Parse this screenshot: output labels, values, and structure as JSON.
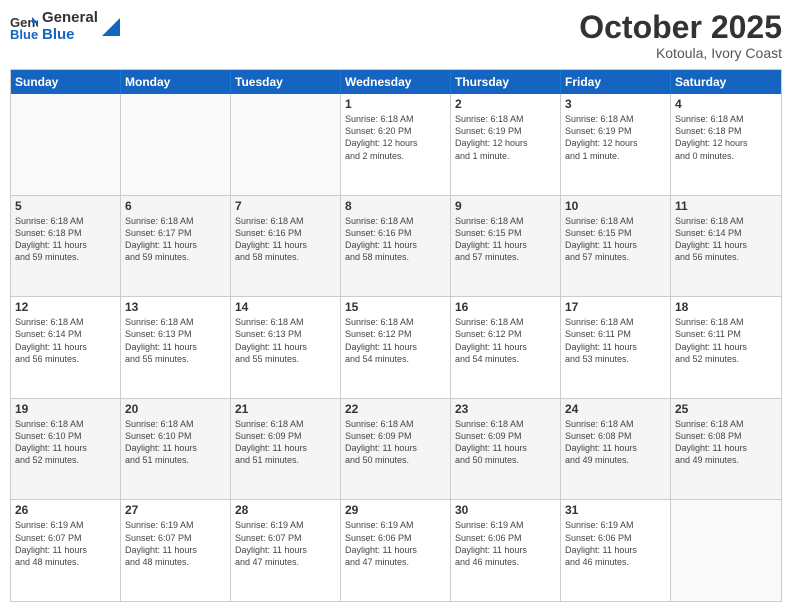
{
  "header": {
    "logo_line1": "General",
    "logo_line2": "Blue",
    "title": "October 2025",
    "subtitle": "Kotoula, Ivory Coast"
  },
  "days_of_week": [
    "Sunday",
    "Monday",
    "Tuesday",
    "Wednesday",
    "Thursday",
    "Friday",
    "Saturday"
  ],
  "weeks": [
    [
      {
        "day": "",
        "info": ""
      },
      {
        "day": "",
        "info": ""
      },
      {
        "day": "",
        "info": ""
      },
      {
        "day": "1",
        "info": "Sunrise: 6:18 AM\nSunset: 6:20 PM\nDaylight: 12 hours\nand 2 minutes."
      },
      {
        "day": "2",
        "info": "Sunrise: 6:18 AM\nSunset: 6:19 PM\nDaylight: 12 hours\nand 1 minute."
      },
      {
        "day": "3",
        "info": "Sunrise: 6:18 AM\nSunset: 6:19 PM\nDaylight: 12 hours\nand 1 minute."
      },
      {
        "day": "4",
        "info": "Sunrise: 6:18 AM\nSunset: 6:18 PM\nDaylight: 12 hours\nand 0 minutes."
      }
    ],
    [
      {
        "day": "5",
        "info": "Sunrise: 6:18 AM\nSunset: 6:18 PM\nDaylight: 11 hours\nand 59 minutes."
      },
      {
        "day": "6",
        "info": "Sunrise: 6:18 AM\nSunset: 6:17 PM\nDaylight: 11 hours\nand 59 minutes."
      },
      {
        "day": "7",
        "info": "Sunrise: 6:18 AM\nSunset: 6:16 PM\nDaylight: 11 hours\nand 58 minutes."
      },
      {
        "day": "8",
        "info": "Sunrise: 6:18 AM\nSunset: 6:16 PM\nDaylight: 11 hours\nand 58 minutes."
      },
      {
        "day": "9",
        "info": "Sunrise: 6:18 AM\nSunset: 6:15 PM\nDaylight: 11 hours\nand 57 minutes."
      },
      {
        "day": "10",
        "info": "Sunrise: 6:18 AM\nSunset: 6:15 PM\nDaylight: 11 hours\nand 57 minutes."
      },
      {
        "day": "11",
        "info": "Sunrise: 6:18 AM\nSunset: 6:14 PM\nDaylight: 11 hours\nand 56 minutes."
      }
    ],
    [
      {
        "day": "12",
        "info": "Sunrise: 6:18 AM\nSunset: 6:14 PM\nDaylight: 11 hours\nand 56 minutes."
      },
      {
        "day": "13",
        "info": "Sunrise: 6:18 AM\nSunset: 6:13 PM\nDaylight: 11 hours\nand 55 minutes."
      },
      {
        "day": "14",
        "info": "Sunrise: 6:18 AM\nSunset: 6:13 PM\nDaylight: 11 hours\nand 55 minutes."
      },
      {
        "day": "15",
        "info": "Sunrise: 6:18 AM\nSunset: 6:12 PM\nDaylight: 11 hours\nand 54 minutes."
      },
      {
        "day": "16",
        "info": "Sunrise: 6:18 AM\nSunset: 6:12 PM\nDaylight: 11 hours\nand 54 minutes."
      },
      {
        "day": "17",
        "info": "Sunrise: 6:18 AM\nSunset: 6:11 PM\nDaylight: 11 hours\nand 53 minutes."
      },
      {
        "day": "18",
        "info": "Sunrise: 6:18 AM\nSunset: 6:11 PM\nDaylight: 11 hours\nand 52 minutes."
      }
    ],
    [
      {
        "day": "19",
        "info": "Sunrise: 6:18 AM\nSunset: 6:10 PM\nDaylight: 11 hours\nand 52 minutes."
      },
      {
        "day": "20",
        "info": "Sunrise: 6:18 AM\nSunset: 6:10 PM\nDaylight: 11 hours\nand 51 minutes."
      },
      {
        "day": "21",
        "info": "Sunrise: 6:18 AM\nSunset: 6:09 PM\nDaylight: 11 hours\nand 51 minutes."
      },
      {
        "day": "22",
        "info": "Sunrise: 6:18 AM\nSunset: 6:09 PM\nDaylight: 11 hours\nand 50 minutes."
      },
      {
        "day": "23",
        "info": "Sunrise: 6:18 AM\nSunset: 6:09 PM\nDaylight: 11 hours\nand 50 minutes."
      },
      {
        "day": "24",
        "info": "Sunrise: 6:18 AM\nSunset: 6:08 PM\nDaylight: 11 hours\nand 49 minutes."
      },
      {
        "day": "25",
        "info": "Sunrise: 6:18 AM\nSunset: 6:08 PM\nDaylight: 11 hours\nand 49 minutes."
      }
    ],
    [
      {
        "day": "26",
        "info": "Sunrise: 6:19 AM\nSunset: 6:07 PM\nDaylight: 11 hours\nand 48 minutes."
      },
      {
        "day": "27",
        "info": "Sunrise: 6:19 AM\nSunset: 6:07 PM\nDaylight: 11 hours\nand 48 minutes."
      },
      {
        "day": "28",
        "info": "Sunrise: 6:19 AM\nSunset: 6:07 PM\nDaylight: 11 hours\nand 47 minutes."
      },
      {
        "day": "29",
        "info": "Sunrise: 6:19 AM\nSunset: 6:06 PM\nDaylight: 11 hours\nand 47 minutes."
      },
      {
        "day": "30",
        "info": "Sunrise: 6:19 AM\nSunset: 6:06 PM\nDaylight: 11 hours\nand 46 minutes."
      },
      {
        "day": "31",
        "info": "Sunrise: 6:19 AM\nSunset: 6:06 PM\nDaylight: 11 hours\nand 46 minutes."
      },
      {
        "day": "",
        "info": ""
      }
    ]
  ]
}
